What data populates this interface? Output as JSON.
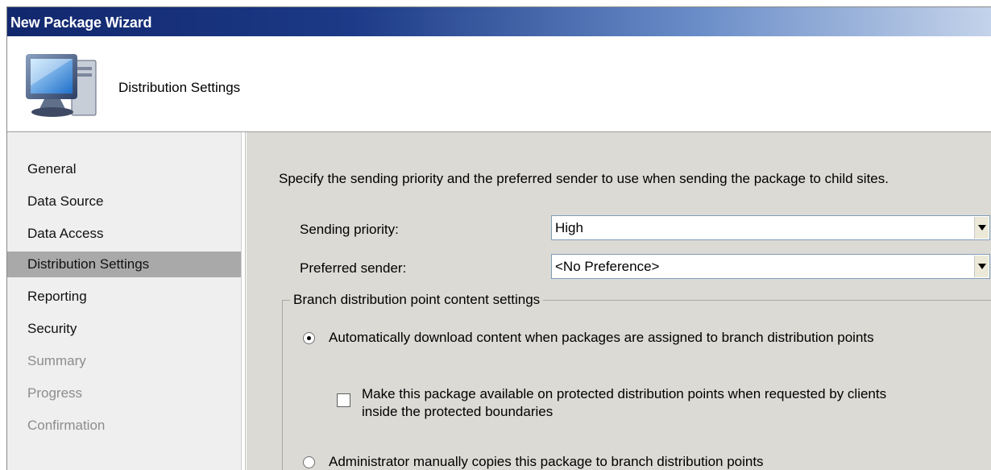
{
  "window": {
    "title": "New Package Wizard"
  },
  "header": {
    "heading": "Distribution Settings",
    "icon": "computer-monitor-icon"
  },
  "nav": {
    "items": [
      {
        "label": "General",
        "state": "normal"
      },
      {
        "label": "Data Source",
        "state": "normal"
      },
      {
        "label": "Data Access",
        "state": "normal"
      },
      {
        "label": "Distribution Settings",
        "state": "selected"
      },
      {
        "label": "Reporting",
        "state": "normal"
      },
      {
        "label": "Security",
        "state": "normal"
      },
      {
        "label": "Summary",
        "state": "disabled"
      },
      {
        "label": "Progress",
        "state": "disabled"
      },
      {
        "label": "Confirmation",
        "state": "disabled"
      }
    ]
  },
  "content": {
    "intro": "Specify the sending priority and the preferred sender to use when sending the package to child sites.",
    "sending_priority": {
      "label": "Sending priority:",
      "value": "High"
    },
    "preferred_sender": {
      "label": "Preferred sender:",
      "value": "<No Preference>"
    },
    "branch_group": {
      "legend": "Branch distribution point content settings",
      "auto_download": {
        "label": "Automatically download content when packages are assigned to branch distribution points",
        "checked": true
      },
      "protected_checkbox": {
        "line1": "Make this package available on protected distribution points when requested by clients",
        "line2": "inside the protected boundaries",
        "checked": false
      },
      "manual_copy": {
        "label": "Administrator manually copies this package to branch distribution points",
        "checked": false
      }
    }
  },
  "colors": {
    "title_gradient_start": "#12276d",
    "title_gradient_end": "#c4d3ea",
    "nav_selected": "#a9a9a9",
    "content_bg": "#dcdad5"
  }
}
